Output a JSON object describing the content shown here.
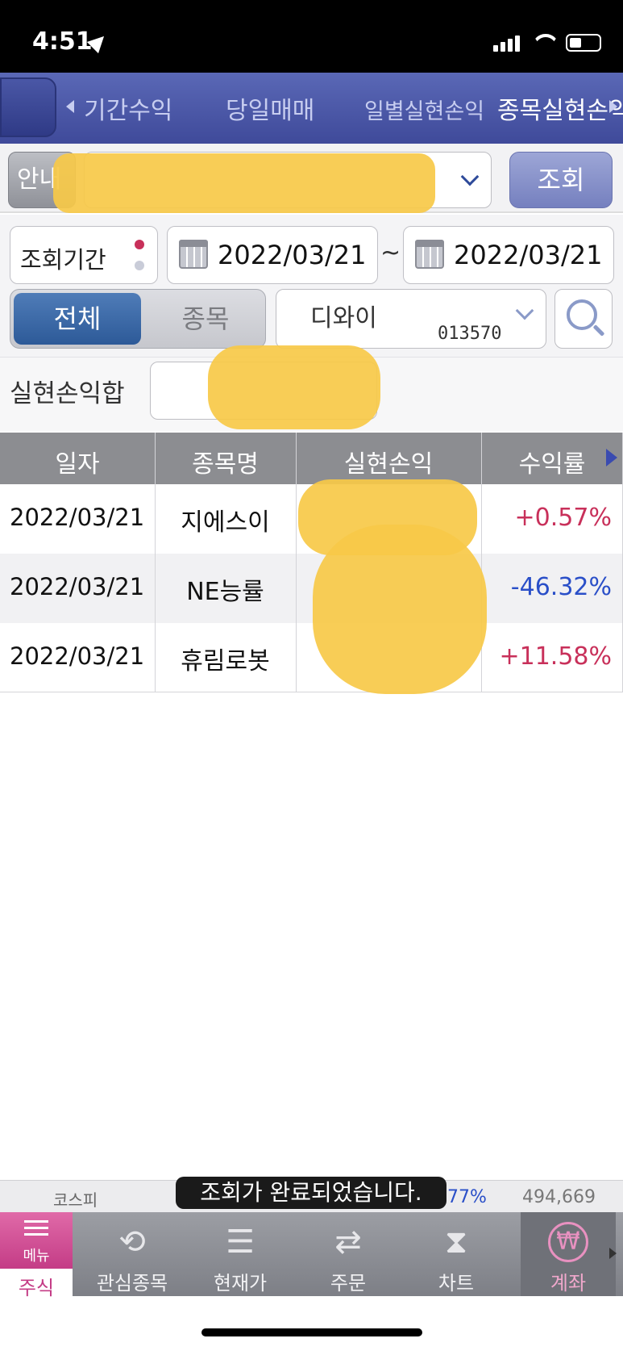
{
  "status_bar": {
    "time": "4:51"
  },
  "tabs": [
    {
      "label": "기간수익"
    },
    {
      "label": "당일매매"
    },
    {
      "label": "일별실현손익"
    },
    {
      "label": "종목실현손익"
    }
  ],
  "account": {
    "guide_label": "안내",
    "query_button": "조회"
  },
  "period": {
    "label": "조회기간",
    "start_date": "2022/03/21",
    "separator": "~",
    "end_date": "2022/03/21"
  },
  "filter": {
    "all_label": "전체",
    "stock_label": "종목",
    "stock_name": "디와이",
    "stock_code": "013570"
  },
  "sum_label": "실현손익합",
  "table": {
    "columns": [
      "일자",
      "종목명",
      "실현손익",
      "수익률"
    ],
    "rows": [
      {
        "date": "2022/03/21",
        "name": "지에스이",
        "rate": "+0.57%",
        "rate_color": "#c8305a"
      },
      {
        "date": "2022/03/21",
        "name": "NE능률",
        "rate": "-46.32%",
        "rate_color": "#2a4fc8"
      },
      {
        "date": "2022/03/21",
        "name": "휴림로봇",
        "rate": "+11.58%",
        "rate_color": "#c8305a"
      }
    ]
  },
  "ticker": {
    "index_name": "코스피",
    "index_change": ".77%",
    "volume": "494,669"
  },
  "toast": "조회가 완료되었습니다.",
  "bottom_nav": [
    {
      "label": "주식",
      "sub": "메뉴"
    },
    {
      "label": "관심종목"
    },
    {
      "label": "현재가"
    },
    {
      "label": "주문"
    },
    {
      "label": "차트"
    },
    {
      "label": "계좌"
    }
  ],
  "colors": {
    "header_blue": "#4a57a6",
    "positive": "#c8305a",
    "negative": "#2a4fc8",
    "menu_pink": "#d6488f"
  }
}
